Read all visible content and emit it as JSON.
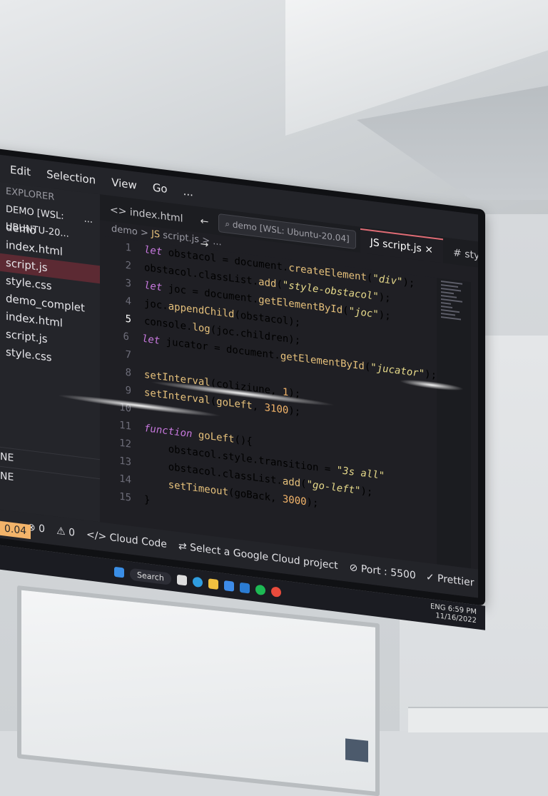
{
  "menubar": {
    "items": [
      "Edit",
      "Selection",
      "View",
      "Go",
      "..."
    ]
  },
  "sidebar": {
    "header": "EXPLORER",
    "workspace": "DEMO [WSL: UBUNTU-20...",
    "workspace_more": "...",
    "tree": [
      "demo",
      "index.html",
      "script.js",
      "style.css",
      "demo_complet",
      "index.html",
      "script.js",
      "style.css"
    ],
    "panels": [
      "NE",
      "NE"
    ],
    "version": "0.04"
  },
  "tabs": {
    "items": [
      "index.html",
      "script.js",
      "style.css"
    ],
    "active_close": "×",
    "search": "demo [WSL: Ubuntu-20.04]",
    "nav": "← →"
  },
  "breadcrumb": [
    "demo",
    ">",
    "script.js",
    ">",
    "..."
  ],
  "editor": {
    "lines": [
      {
        "n": "1",
        "code": "let obstacol = document.createElement(\"div\");"
      },
      {
        "n": "2",
        "code": "obstacol.classList.add(\"style-obstacol\");"
      },
      {
        "n": "3",
        "code": "let joc = document.getElementById(\"joc\");"
      },
      {
        "n": "4",
        "code": "joc.appendChild(obstacol);"
      },
      {
        "n": "5",
        "code": "console.log(joc.children);"
      },
      {
        "n": "6",
        "code": "let jucator = document.getElementById(\"jucator\");"
      },
      {
        "n": "7",
        "code": ""
      },
      {
        "n": "8",
        "code": "setInterval(coliziune, 1);"
      },
      {
        "n": "9",
        "code": "setInterval(goLeft, 3100);"
      },
      {
        "n": "10",
        "code": ""
      },
      {
        "n": "11",
        "code": "function goLeft(){"
      },
      {
        "n": "12",
        "code": "    obstacol.style.transition = \"3s all\""
      },
      {
        "n": "13",
        "code": "    obstacol.classList.add(\"go-left\");"
      },
      {
        "n": "14",
        "code": "    setTimeout(goBack, 3000);"
      },
      {
        "n": "15",
        "code": "}"
      }
    ],
    "current_line": "5"
  },
  "statusbar": {
    "errors": "⊗ 0",
    "warnings": "⚠ 0",
    "cloud_code": "</> Cloud Code",
    "gcp": "⇄ Select a Google Cloud project",
    "port": "⊘ Port : 5500",
    "prettier": "✓ Prettier"
  },
  "taskbar": {
    "search": "Search",
    "lang": "ENG",
    "time": "6:59 PM",
    "date": "11/16/2022"
  },
  "colors": {
    "accent_tab": "#e06c75",
    "version_badge": "#f3b46a",
    "selected_row": "#5c2a33"
  }
}
